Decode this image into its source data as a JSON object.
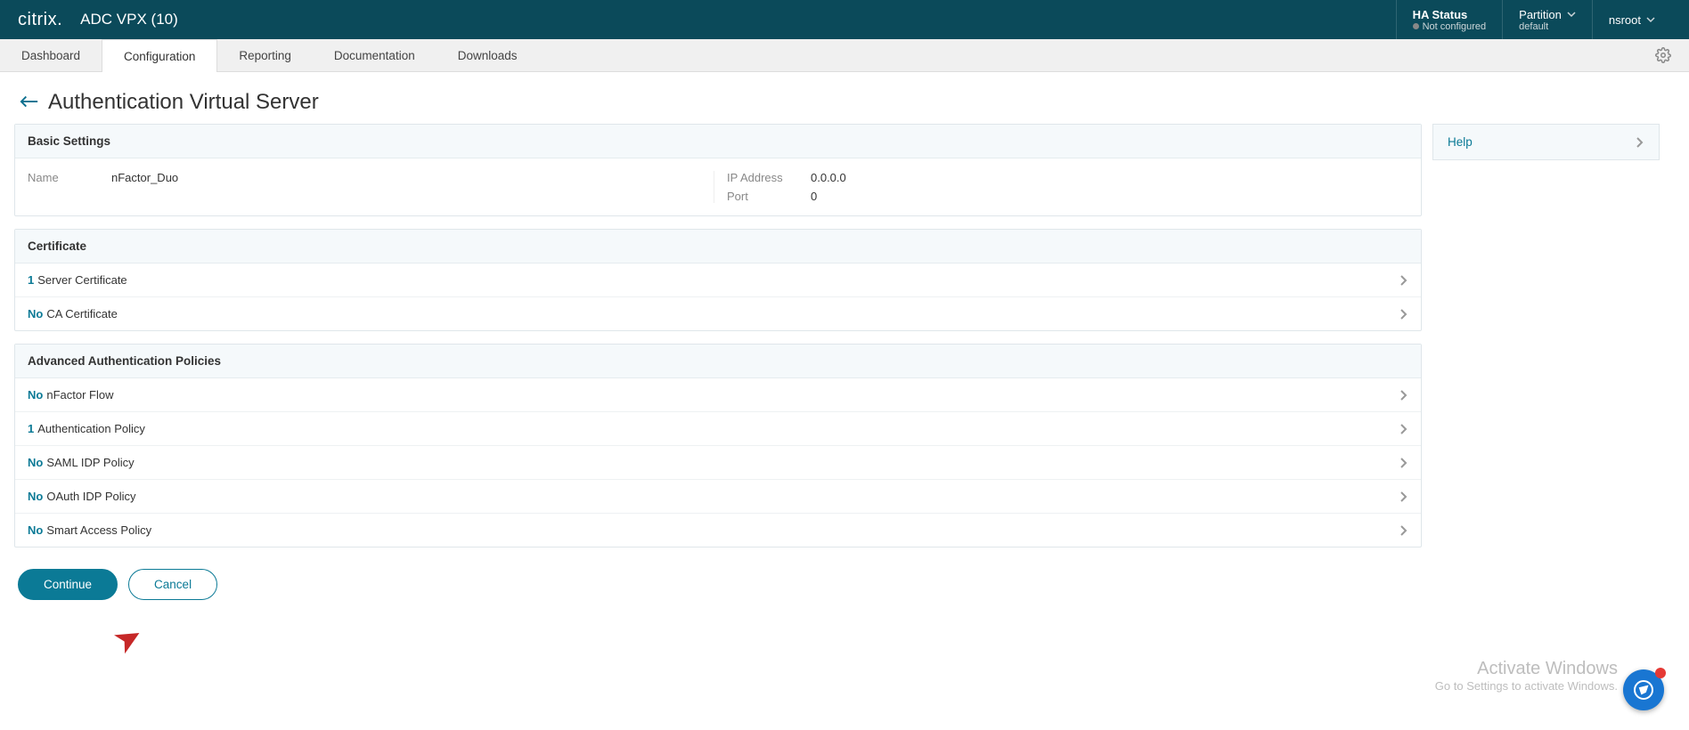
{
  "topbar": {
    "logo": "citrix.",
    "product": "ADC VPX (10)",
    "ha_label": "HA Status",
    "ha_status": "Not configured",
    "partition_label": "Partition",
    "partition_value": "default",
    "user": "nsroot"
  },
  "nav": {
    "items": [
      "Dashboard",
      "Configuration",
      "Reporting",
      "Documentation",
      "Downloads"
    ],
    "active_index": 1
  },
  "page": {
    "title": "Authentication Virtual Server"
  },
  "basic": {
    "header": "Basic Settings",
    "name_label": "Name",
    "name_value": "nFactor_Duo",
    "ip_label": "IP Address",
    "ip_value": "0.0.0.0",
    "port_label": "Port",
    "port_value": "0"
  },
  "certificate": {
    "header": "Certificate",
    "rows": [
      {
        "count": "1",
        "label": "Server Certificate"
      },
      {
        "count": "No",
        "label": "CA Certificate"
      }
    ]
  },
  "policies": {
    "header": "Advanced Authentication Policies",
    "rows": [
      {
        "count": "No",
        "label": "nFactor Flow"
      },
      {
        "count": "1",
        "label": "Authentication Policy"
      },
      {
        "count": "No",
        "label": "SAML IDP Policy"
      },
      {
        "count": "No",
        "label": "OAuth IDP Policy"
      },
      {
        "count": "No",
        "label": "Smart Access Policy"
      }
    ]
  },
  "buttons": {
    "continue": "Continue",
    "cancel": "Cancel"
  },
  "sidebar": {
    "help": "Help"
  },
  "watermark": {
    "line1": "Activate Windows",
    "line2": "Go to Settings to activate Windows."
  }
}
